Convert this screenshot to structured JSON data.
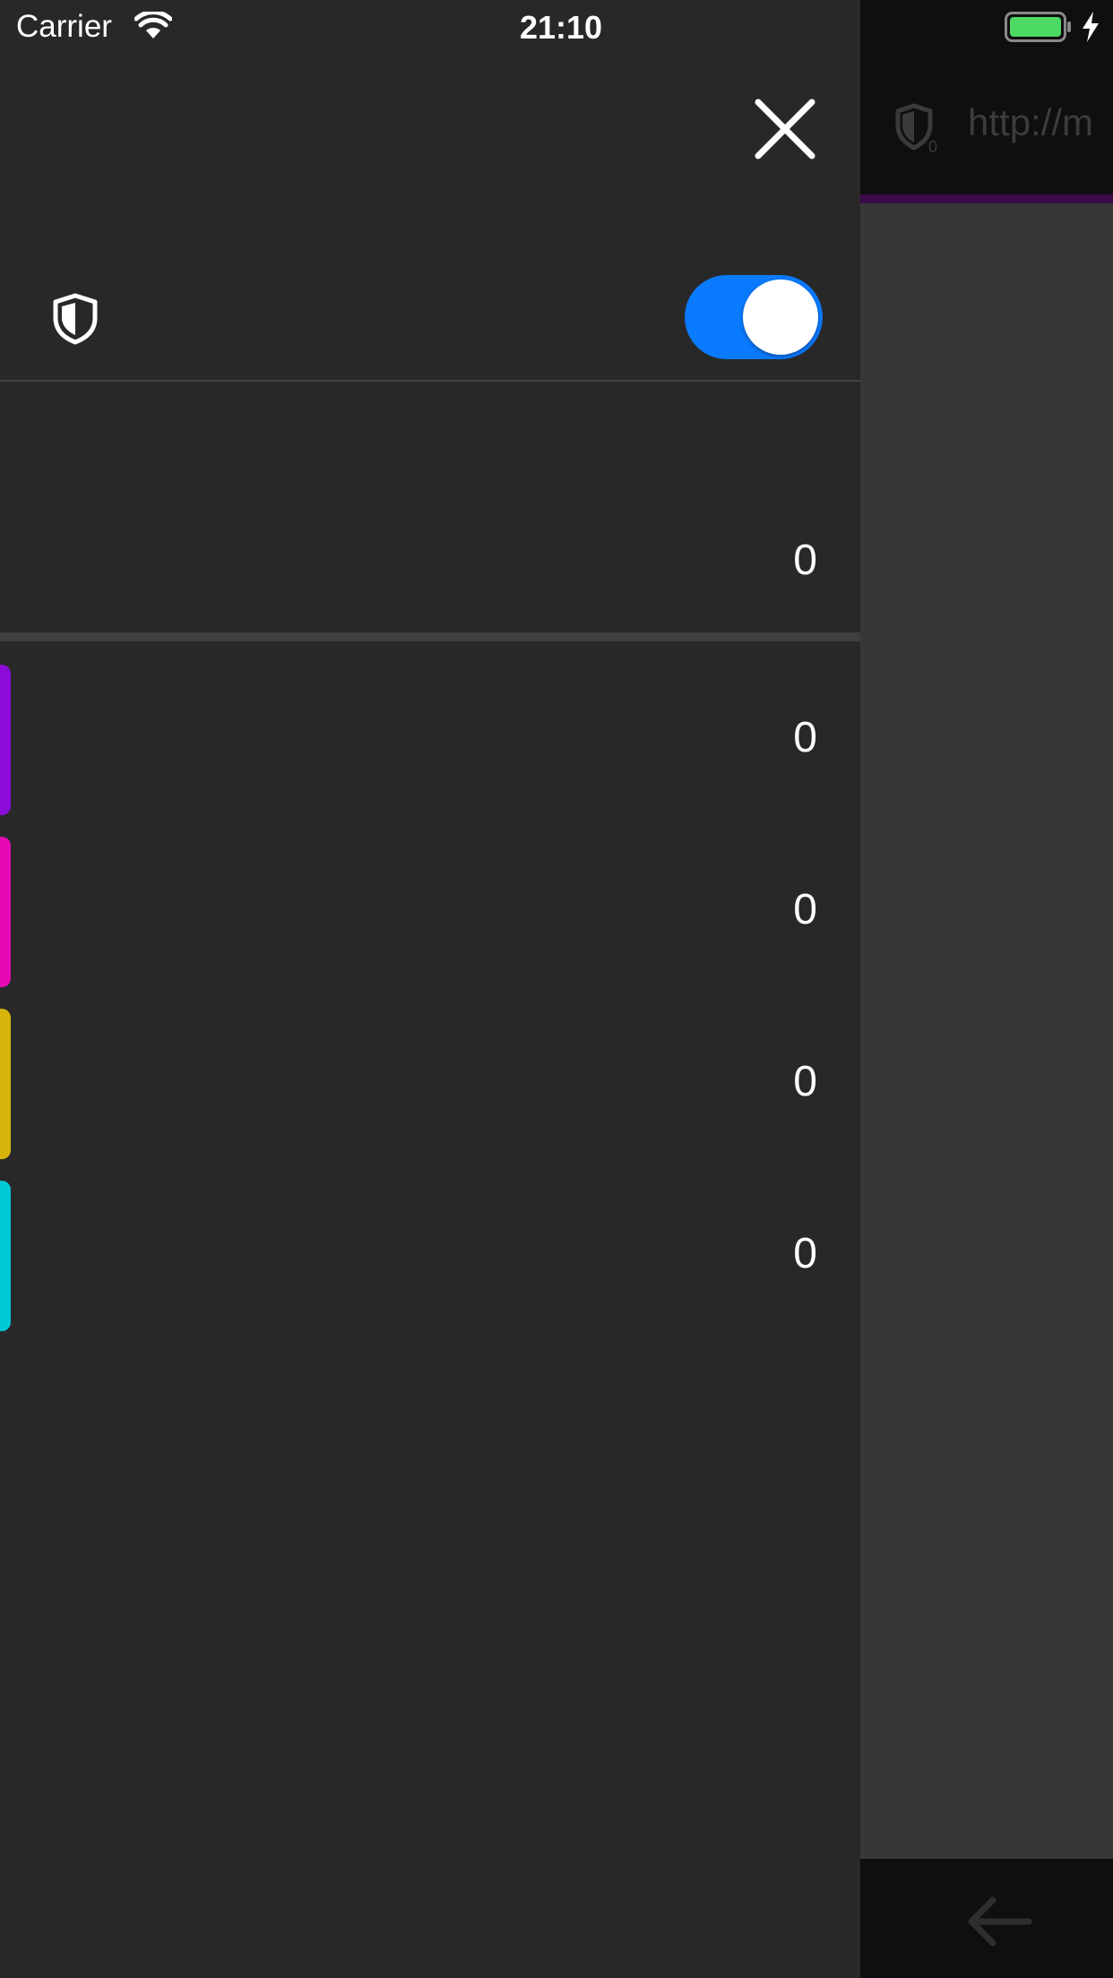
{
  "status_bar": {
    "carrier": "Carrier",
    "time": "21:10",
    "battery_color": "#4cd964",
    "icons": [
      "wifi-icon",
      "battery-icon",
      "charging-bolt-icon"
    ]
  },
  "background_browser": {
    "url_text": "http://m",
    "progress_color": "#3a0a48",
    "icons": [
      "shield-count-icon",
      "back-arrow-icon"
    ]
  },
  "panel": {
    "close_icon": "close-icon",
    "shield_icon": "shield-icon",
    "toggle": {
      "on": true,
      "color": "#0a7aff"
    },
    "total_count": "0",
    "categories": [
      {
        "color": "#8a0cd6",
        "count": "0"
      },
      {
        "color": "#e60ab3",
        "count": "0"
      },
      {
        "color": "#d6b40a",
        "count": "0"
      },
      {
        "color": "#00c8d7",
        "count": "0"
      }
    ]
  }
}
